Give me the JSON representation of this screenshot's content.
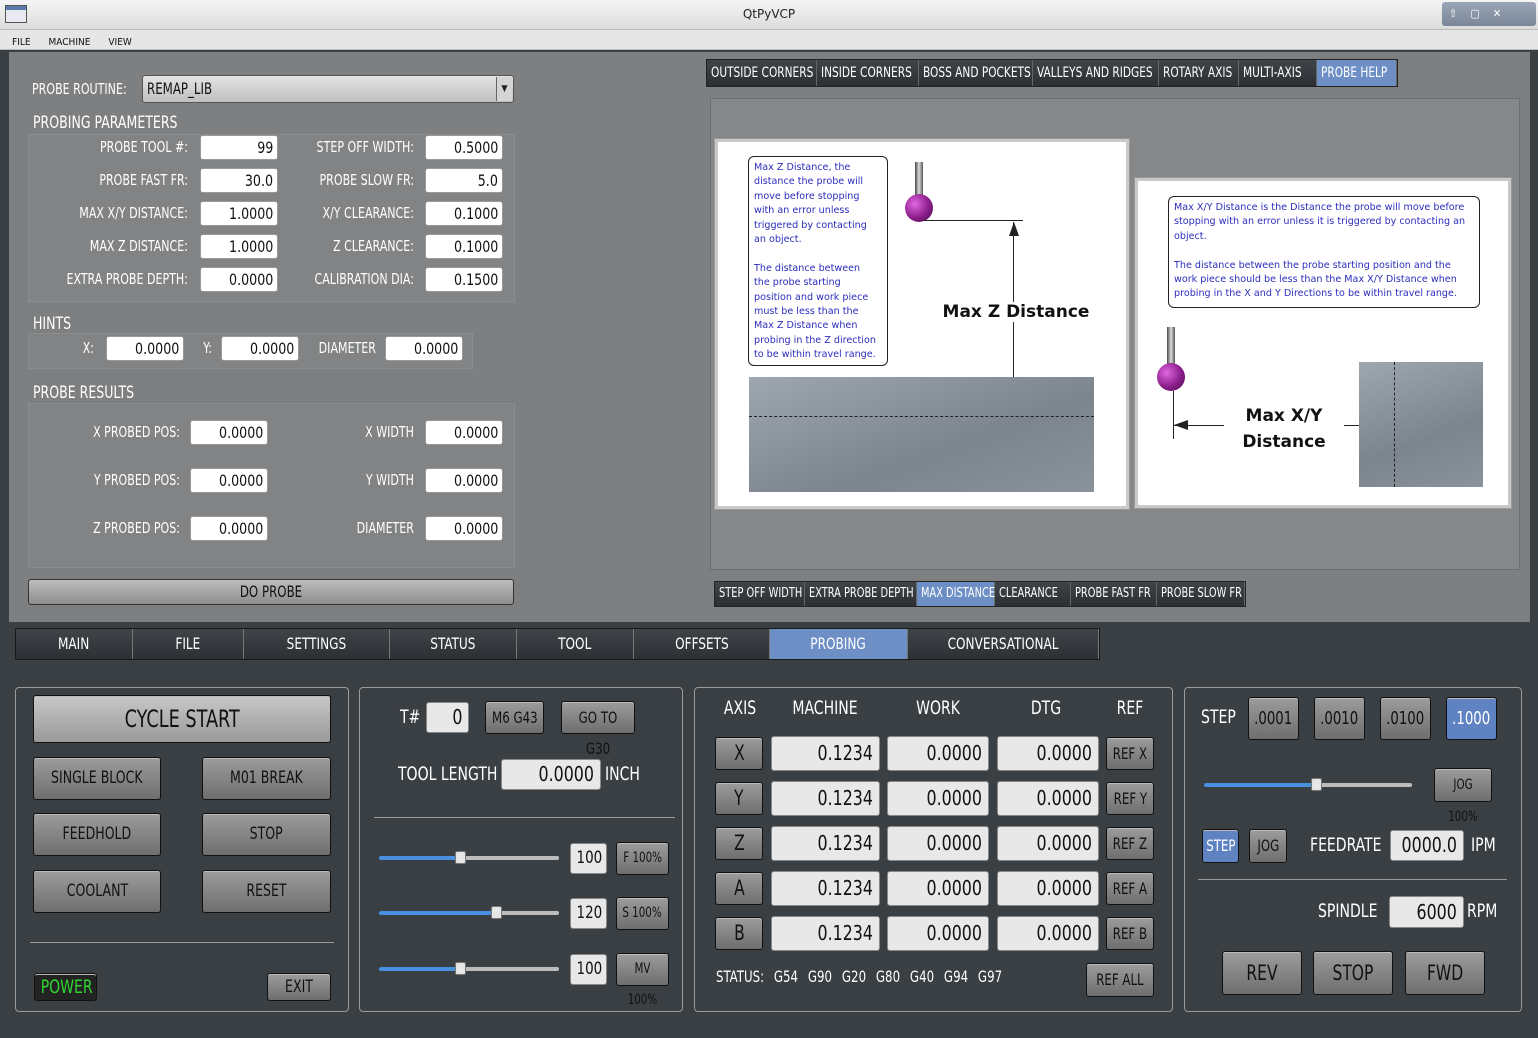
{
  "window": {
    "title": "QtPyVCP",
    "controls": [
      "⇧",
      "▢",
      "✕"
    ]
  },
  "menu": [
    "FILE",
    "MACHINE",
    "VIEW"
  ],
  "probe": {
    "routine_label": "PROBE ROUTINE:",
    "routine_value": "REMAP_LIB",
    "params_header": "PROBING PARAMETERS",
    "params": [
      {
        "label": "PROBE TOOL #:",
        "value": "99",
        "label2": "STEP OFF WIDTH:",
        "value2": "0.5000"
      },
      {
        "label": "PROBE FAST FR:",
        "value": "30.0",
        "label2": "PROBE SLOW FR:",
        "value2": "5.0"
      },
      {
        "label": "MAX X/Y DISTANCE:",
        "value": "1.0000",
        "label2": "X/Y CLEARANCE:",
        "value2": "0.1000"
      },
      {
        "label": "MAX Z DISTANCE:",
        "value": "1.0000",
        "label2": "Z CLEARANCE:",
        "value2": "0.1000"
      },
      {
        "label": "EXTRA PROBE DEPTH:",
        "value": "0.0000",
        "label2": "CALIBRATION DIA:",
        "value2": "0.1500"
      }
    ],
    "hints_header": "HINTS",
    "hints": {
      "x_label": "X:",
      "x": "0.0000",
      "y_label": "Y:",
      "y": "0.0000",
      "d_label": "DIAMETER",
      "d": "0.0000"
    },
    "results_header": "PROBE RESULTS",
    "results": [
      {
        "label": "X PROBED POS:",
        "value": "0.0000",
        "label2": "X WIDTH",
        "value2": "0.0000"
      },
      {
        "label": "Y PROBED POS:",
        "value": "0.0000",
        "label2": "Y WIDTH",
        "value2": "0.0000"
      },
      {
        "label": "Z PROBED POS:",
        "value": "0.0000",
        "label2": "DIAMETER",
        "value2": "0.0000"
      }
    ],
    "do_probe": "DO PROBE"
  },
  "help_tabs": [
    "OUTSIDE CORNERS",
    "INSIDE CORNERS",
    "BOSS AND POCKETS",
    "VALLEYS AND RIDGES",
    "ROTARY AXIS",
    "MULTI-AXIS",
    "PROBE HELP"
  ],
  "help_subtabs": [
    "STEP OFF WIDTH",
    "EXTRA PROBE DEPTH",
    "MAX DISTANCE",
    "CLEARANCE",
    "PROBE FAST FR",
    "PROBE SLOW FR"
  ],
  "help": {
    "z_lines": [
      "Max Z Distance, the",
      "distance the probe will",
      "move before stopping",
      "with an error unless",
      "triggered by contacting",
      "an object.",
      "",
      "The distance between",
      "the probe starting",
      "position and work piece",
      "must be less than the",
      "Max Z Distance when",
      "probing in the Z direction",
      "to be within travel range."
    ],
    "z_title": "Max Z Distance",
    "xy_lines": [
      "Max X/Y Distance is the Distance the probe will move before",
      "stopping with an error unless it is triggered by contacting an",
      "object.",
      "",
      "The distance between the probe starting position and the",
      "work piece should be less than the Max X/Y Distance when",
      "probing in the X and Y Directions to be within travel range."
    ],
    "xy_title1": "Max X/Y",
    "xy_title2": "Distance"
  },
  "main_tabs": [
    "MAIN",
    "FILE",
    "SETTINGS",
    "STATUS",
    "TOOL",
    "OFFSETS",
    "PROBING",
    "CONVERSATIONAL"
  ],
  "control": {
    "cycle_start": "CYCLE START",
    "single_block": "SINGLE BLOCK",
    "m01_break": "M01 BREAK",
    "feedhold": "FEEDHOLD",
    "stop": "STOP",
    "coolant": "COOLANT",
    "reset": "RESET",
    "power": "POWER",
    "exit": "EXIT"
  },
  "tool": {
    "t_label": "T#",
    "t_value": "0",
    "m6g43": "M6 G43",
    "goto_g30": "GO TO G30",
    "tl_label": "TOOL LENGTH",
    "tl_value": "0.0000",
    "tl_unit": "INCH",
    "overrides": [
      {
        "value": "100",
        "btn": "F 100%",
        "fraction": 0.45
      },
      {
        "value": "120",
        "btn": "S 100%",
        "fraction": 0.65
      },
      {
        "value": "100",
        "btn": "MV 100%",
        "fraction": 0.45
      }
    ]
  },
  "dro": {
    "headers": [
      "AXIS",
      "MACHINE",
      "WORK",
      "DTG",
      "REF"
    ],
    "rows": [
      {
        "axis": "X",
        "machine": "0.1234",
        "work": "0.0000",
        "dtg": "0.0000",
        "ref": "REF X"
      },
      {
        "axis": "Y",
        "machine": "0.1234",
        "work": "0.0000",
        "dtg": "0.0000",
        "ref": "REF Y"
      },
      {
        "axis": "Z",
        "machine": "0.1234",
        "work": "0.0000",
        "dtg": "0.0000",
        "ref": "REF Z"
      },
      {
        "axis": "A",
        "machine": "0.1234",
        "work": "0.0000",
        "dtg": "0.0000",
        "ref": "REF A"
      },
      {
        "axis": "B",
        "machine": "0.1234",
        "work": "0.0000",
        "dtg": "0.0000",
        "ref": "REF B"
      }
    ],
    "status_label": "STATUS:",
    "status_codes": [
      "G54",
      "G90",
      "G20",
      "G80",
      "G40",
      "G94",
      "G97"
    ],
    "ref_all": "REF ALL"
  },
  "jog": {
    "step_label": "STEP",
    "steps": [
      ".0001",
      ".0010",
      ".0100",
      ".1000"
    ],
    "jog_btn": "JOG 100%",
    "jog_fraction": 0.54,
    "step": "STEP",
    "jog": "JOG",
    "feedrate_label": "FEEDRATE",
    "feedrate": "0000.0",
    "feed_unit": "IPM",
    "spindle_label": "SPINDLE",
    "spindle": "6000",
    "spindle_unit": "RPM",
    "rev": "REV",
    "sp_stop": "STOP",
    "fwd": "FWD"
  },
  "colors": {
    "accent": "#6d8fc6",
    "power": "#2fd62f",
    "panel_bg": "#3a3f44",
    "top_bg": "#7d7f81"
  }
}
